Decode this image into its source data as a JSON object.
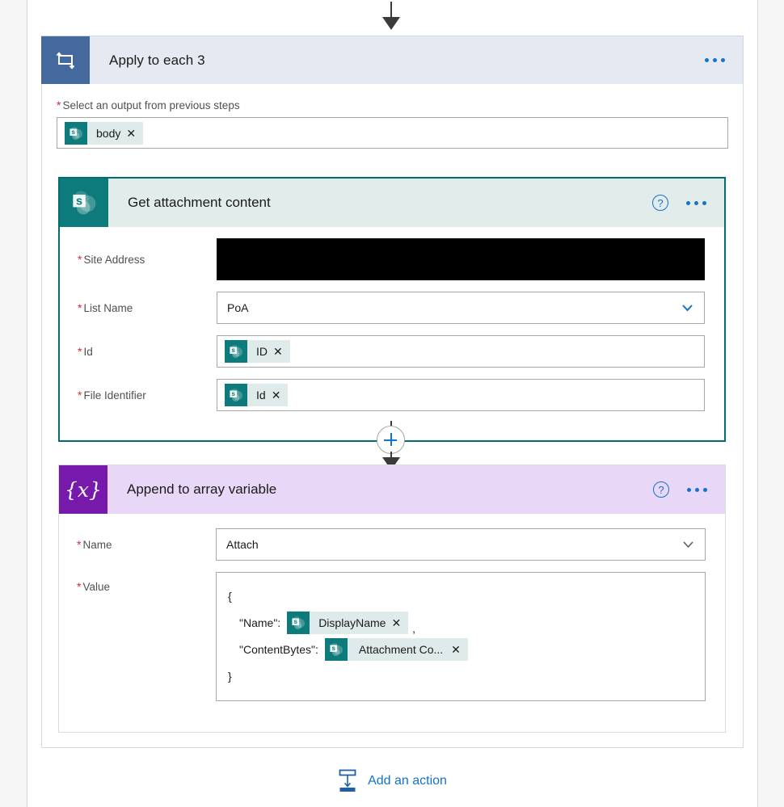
{
  "flow": {
    "top_connector_icon": "arrow-down-icon",
    "scope": {
      "icon": "foreach-loop-icon",
      "title": "Apply to each 3",
      "menu_icon": "ellipsis-icon",
      "field": {
        "required_marker": "*",
        "label": "Select an output from previous steps",
        "token": {
          "icon": "sharepoint-icon",
          "text": "body",
          "remove_icon": "✕"
        }
      }
    },
    "connector": {
      "plus_icon": "plus-icon",
      "arrow_icon": "arrow-down-icon"
    },
    "cards": [
      {
        "id": "get-attachment-content",
        "icon": "sharepoint-icon",
        "title": "Get attachment content",
        "help_icon": "?",
        "menu_icon": "ellipsis-icon",
        "selected": true,
        "fields": [
          {
            "required_marker": "*",
            "label": "Site Address",
            "type": "redacted",
            "value": ""
          },
          {
            "required_marker": "*",
            "label": "List Name",
            "type": "dropdown",
            "value": "PoA",
            "chevron_icon": "chevron-down-icon"
          },
          {
            "required_marker": "*",
            "label": "Id",
            "type": "token",
            "token": {
              "icon": "sharepoint-icon",
              "text": "ID",
              "remove_icon": "✕"
            }
          },
          {
            "required_marker": "*",
            "label": "File Identifier",
            "type": "token",
            "token": {
              "icon": "sharepoint-icon",
              "text": "Id",
              "remove_icon": "✕"
            }
          }
        ]
      },
      {
        "id": "append-to-array-variable",
        "icon": "variables-icon",
        "icon_glyph": "{x}",
        "title": "Append to array variable",
        "help_icon": "?",
        "menu_icon": "ellipsis-icon",
        "selected": false,
        "fields": [
          {
            "required_marker": "*",
            "label": "Name",
            "type": "dropdown",
            "value": "Attach",
            "chevron_icon": "chevron-down-icon"
          },
          {
            "required_marker": "*",
            "label": "Value",
            "type": "code",
            "lines": [
              {
                "text": "{",
                "indent": false
              },
              {
                "text": "\"Name\":",
                "indent": true,
                "token": {
                  "icon": "sharepoint-icon",
                  "text": "DisplayName",
                  "remove_icon": "✕"
                },
                "trailing": ","
              },
              {
                "text": "\"ContentBytes\":",
                "indent": true,
                "token": {
                  "icon": "sharepoint-icon",
                  "text": "Attachment Co...",
                  "remove_icon": "✕"
                },
                "trailing": ""
              },
              {
                "text": "}",
                "indent": false
              }
            ]
          }
        ]
      }
    ],
    "add_action": {
      "icon": "insert-below-icon",
      "label": "Add an action"
    }
  },
  "colors": {
    "scope_header_bg": "#e4e9f2",
    "scope_icon_bg": "#44699d",
    "sharepoint_teal": "#0d7b7b",
    "sharepoint_card_header": "#e1eceb",
    "selected_border": "#036c70",
    "variables_purple": "#7719aa",
    "variables_card_header": "#e9d7f7",
    "accent_blue": "#1272cc",
    "required_red": "#d6273a",
    "token_chip_bg": "#dfeaea"
  }
}
